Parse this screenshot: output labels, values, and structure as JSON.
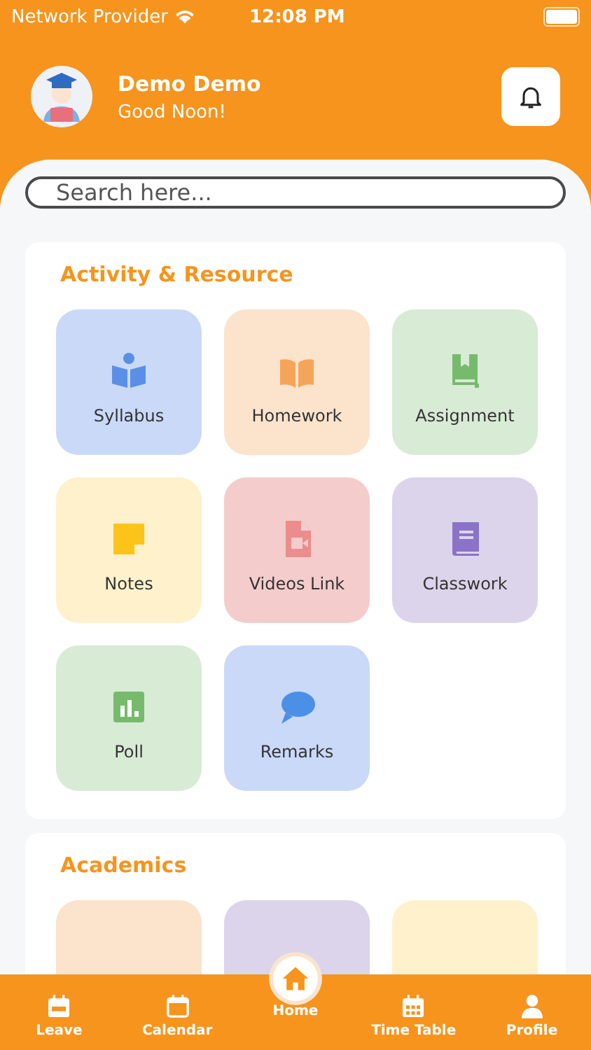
{
  "status_bar": {
    "carrier": "Network Provider",
    "time": "12:08 PM"
  },
  "header": {
    "name": "Demo Demo",
    "greeting": "Good Noon!"
  },
  "search": {
    "placeholder": "Search here..."
  },
  "activity": {
    "title": "Activity & Resource",
    "tiles": [
      {
        "label": "Syllabus",
        "color": "#c9d9f7"
      },
      {
        "label": "Homework",
        "color": "#fbe3cc"
      },
      {
        "label": "Assignment",
        "color": "#d8ebd5"
      },
      {
        "label": "Notes",
        "color": "#fef1cc"
      },
      {
        "label": "Videos Link",
        "color": "#f4cccc"
      },
      {
        "label": "Classwork",
        "color": "#dcd4eb"
      },
      {
        "label": "Poll",
        "color": "#d8ebd5"
      },
      {
        "label": "Remarks",
        "color": "#c9d9f7"
      }
    ]
  },
  "academics": {
    "title": "Academics",
    "tiles": [
      {
        "color": "#fbe3cc"
      },
      {
        "color": "#dcd4eb"
      },
      {
        "color": "#fef1cc"
      }
    ]
  },
  "nav": [
    {
      "label": "Leave",
      "selected": false
    },
    {
      "label": "Calendar",
      "selected": false
    },
    {
      "label": "Home",
      "selected": true
    },
    {
      "label": "Time Table",
      "selected": false
    },
    {
      "label": "Profile",
      "selected": false
    }
  ]
}
